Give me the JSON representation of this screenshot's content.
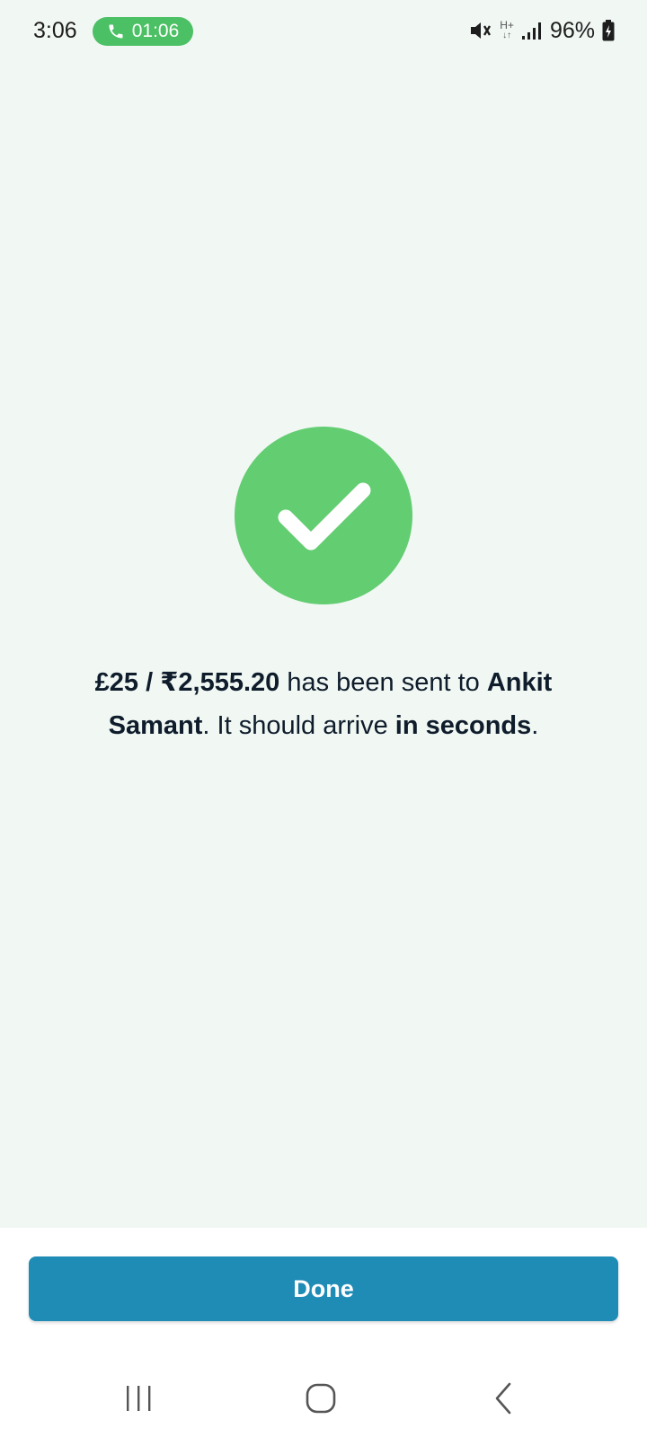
{
  "status_bar": {
    "time": "3:06",
    "call_timer": "01:06",
    "call_icon": "phone-icon",
    "mute_icon": "vibrate-mute-icon",
    "network_type": "H+",
    "signal_icon": "signal-icon",
    "battery_percent": "96%",
    "battery_icon": "battery-charging-icon"
  },
  "success": {
    "icon": "checkmark-icon",
    "amount": "£25 / ₹2,555.20",
    "text_sent": " has been sent to ",
    "recipient": "Ankit Samant",
    "text_arrive": ". It should arrive ",
    "timing": "in seconds",
    "text_end": "."
  },
  "actions": {
    "done_label": "Done"
  },
  "nav_bar": {
    "recent_icon": "recent-apps-icon",
    "home_icon": "home-icon",
    "back_icon": "back-icon"
  },
  "colors": {
    "background": "#f1f7f3",
    "success_green": "#63cd72",
    "primary_button": "#1f8cb6",
    "call_pill": "#4cc064"
  }
}
